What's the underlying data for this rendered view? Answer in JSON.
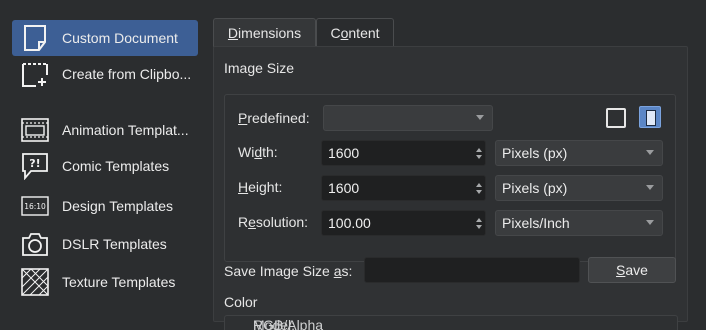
{
  "sidebar": {
    "items": [
      {
        "label": "Custom Document",
        "icon": "blank-page-icon",
        "active": true
      },
      {
        "label": "Create from Clipbo...",
        "icon": "clipboard-page-icon",
        "active": false
      },
      {
        "label": "Animation Templat...",
        "icon": "film-frame-icon",
        "active": false
      },
      {
        "label": "Comic Templates",
        "icon": "speech-bubble-icon",
        "active": false
      },
      {
        "label": "Design Templates",
        "icon": "aspect-ratio-icon",
        "active": false
      },
      {
        "label": "DSLR Templates",
        "icon": "camera-icon",
        "active": false
      },
      {
        "label": "Texture Templates",
        "icon": "texture-pattern-icon",
        "active": false
      }
    ],
    "badge_16_10": "16:10",
    "comic_glyph": "?!"
  },
  "tabs": {
    "dimensions": {
      "pre": "",
      "key": "D",
      "post": "imensions"
    },
    "content": {
      "pre": "C",
      "key": "o",
      "post": "ntent"
    }
  },
  "image_size": {
    "title": "Image Size",
    "predefined": {
      "pre": "",
      "key": "P",
      "post": "redefined:",
      "value": ""
    },
    "width": {
      "pre": "Wi",
      "key": "d",
      "post": "th:",
      "value": "1600",
      "unit": "Pixels (px)"
    },
    "height": {
      "pre": "",
      "key": "H",
      "post": "eight:",
      "value": "1600",
      "unit": "Pixels (px)"
    },
    "resolution": {
      "pre": "R",
      "key": "e",
      "post": "solution:",
      "value": "100.00",
      "unit": "Pixels/Inch"
    },
    "orientation": {
      "landscape": "landscape-icon",
      "portrait": "portrait-icon",
      "selected": "portrait"
    }
  },
  "save_size": {
    "label_pre": "Save Image Size ",
    "label_key": "a",
    "label_post": "s:",
    "value": "",
    "button_key": "S",
    "button_post": "ave"
  },
  "color": {
    "title": "Color",
    "model_label": "Model:",
    "model_value": "RGB/Alpha"
  },
  "colors": {
    "accent": "#3d5f95",
    "portrait_selected": "#5b86c6"
  }
}
